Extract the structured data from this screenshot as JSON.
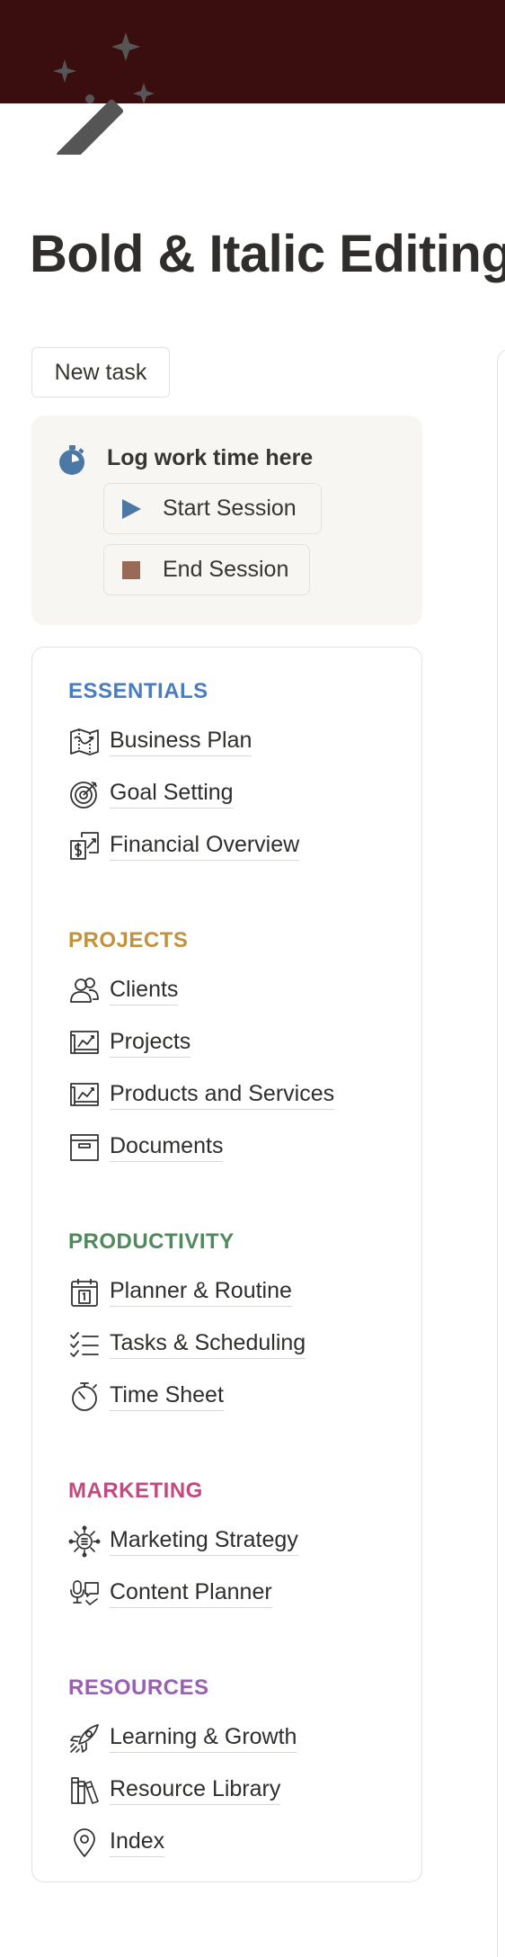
{
  "page": {
    "title": "Bold & Italic Editing",
    "cover_color": "#3a0d0f",
    "icon": "magic-wand-icon"
  },
  "new_task_label": "New task",
  "log": {
    "label": "Log work time here",
    "icon": "stopwatch-icon",
    "start_label": "Start Session",
    "end_label": "End Session"
  },
  "sections": [
    {
      "title": "ESSENTIALS",
      "color": "#4a7dc0",
      "items": [
        {
          "label": "Business Plan",
          "icon": "map-icon"
        },
        {
          "label": "Goal Setting",
          "icon": "target-icon"
        },
        {
          "label": "Financial Overview",
          "icon": "finance-icon"
        }
      ]
    },
    {
      "title": "PROJECTS",
      "color": "#c1923f",
      "items": [
        {
          "label": "Clients",
          "icon": "people-icon"
        },
        {
          "label": "Projects",
          "icon": "chart-icon"
        },
        {
          "label": "Products and Services",
          "icon": "chart-icon"
        },
        {
          "label": "Documents",
          "icon": "archive-box-icon"
        }
      ]
    },
    {
      "title": "PRODUCTIVITY",
      "color": "#4e8a5b",
      "items": [
        {
          "label": "Planner & Routine",
          "icon": "calendar-icon"
        },
        {
          "label": "Tasks & Scheduling",
          "icon": "checklist-icon"
        },
        {
          "label": "Time Sheet",
          "icon": "timer-icon"
        }
      ]
    },
    {
      "title": "MARKETING",
      "color": "#c24a7e",
      "items": [
        {
          "label": "Marketing Strategy",
          "icon": "strategy-gear-icon"
        },
        {
          "label": "Content Planner",
          "icon": "podcast-icon"
        }
      ]
    },
    {
      "title": "RESOURCES",
      "color": "#9a5fb5",
      "items": [
        {
          "label": "Learning & Growth",
          "icon": "rocket-icon"
        },
        {
          "label": "Resource Library",
          "icon": "library-icon"
        },
        {
          "label": "Index",
          "icon": "location-pin-icon"
        }
      ]
    }
  ]
}
